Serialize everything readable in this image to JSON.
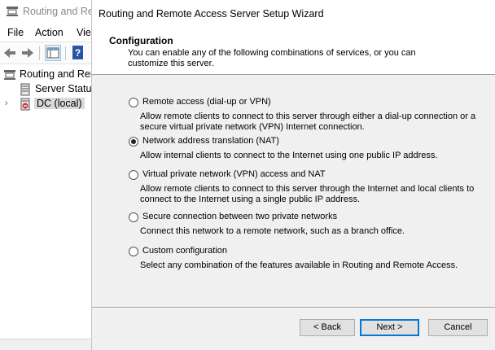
{
  "background_window": {
    "title": "Routing and Re",
    "menu": [
      "File",
      "Action",
      "Vie"
    ],
    "tree": {
      "root_label": "Routing and Ren",
      "items": [
        "Server Status",
        "DC (local)"
      ]
    }
  },
  "dialog": {
    "title": "Routing and Remote Access Server Setup Wizard",
    "header_title": "Configuration",
    "header_subtitle": "You can enable any of the following combinations of services, or you can customize this server.",
    "options": [
      {
        "label": "Remote access (dial-up or VPN)",
        "description": "Allow remote clients to connect to this server through either a dial-up connection or a secure virtual private network (VPN) Internet connection.",
        "selected": false
      },
      {
        "label": "Network address translation (NAT)",
        "description": "Allow internal clients to connect to the Internet using one public IP address.",
        "selected": true
      },
      {
        "label": "Virtual private network (VPN) access and NAT",
        "description": "Allow remote clients to connect to this server through the Internet and local clients to connect to the Internet using a single public IP address.",
        "selected": false
      },
      {
        "label": "Secure connection between two private networks",
        "description": "Connect this network to a remote network, such as a branch office.",
        "selected": false
      },
      {
        "label": "Custom configuration",
        "description": "Select any combination of the features available in Routing and Remote Access.",
        "selected": false
      }
    ],
    "buttons": {
      "back": "< Back",
      "next": "Next >",
      "cancel": "Cancel"
    }
  }
}
